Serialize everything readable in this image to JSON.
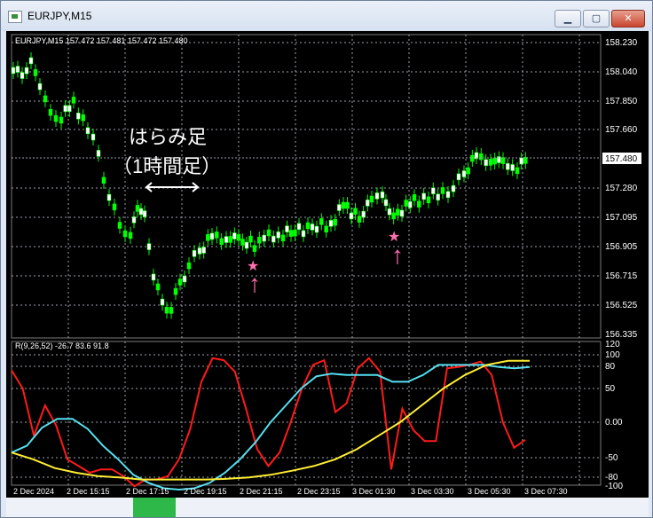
{
  "window": {
    "title": "EURJPY,M15",
    "buttons": {
      "minimize": "▁",
      "maximize": "▢",
      "close": "✕"
    }
  },
  "price_panel": {
    "header": "EURJPY,M15  157.472 157.481 157.472 157.480",
    "current_price": "157.480",
    "y_labels": [
      "158.230",
      "158.040",
      "157.850",
      "157.660",
      "157.470",
      "157.280",
      "157.095",
      "156.905",
      "156.715",
      "156.525",
      "156.335"
    ],
    "annotation_line1": "はらみ足",
    "annotation_line2": "（1時間足）",
    "markers": [
      "★",
      "★"
    ],
    "arrows": [
      "↑",
      "↑"
    ]
  },
  "indicator_panel": {
    "header": "R(9,26,52) -26.7 83.6 91.8",
    "y_labels": [
      "120",
      "100",
      "80",
      "50",
      "0.00",
      "-50",
      "-80",
      "-100"
    ]
  },
  "x_labels": [
    "2 Dec 2024",
    "2 Dec 15:15",
    "2 Dec 17:15",
    "2 Dec 19:15",
    "2 Dec 21:15",
    "2 Dec 23:15",
    "3 Dec 01:30",
    "3 Dec 03:30",
    "3 Dec 05:30",
    "3 Dec 07:30"
  ],
  "colors": {
    "background": "#000000",
    "candle": "#00ff00",
    "grid": "#9aa2ad",
    "red_line": "#ff1a1a",
    "cyan_line": "#55e0f0",
    "yellow_line": "#ffee33",
    "marker": "#ff6fb0",
    "tab_active": "#2fb84a"
  },
  "chart_data": {
    "type": "line",
    "series": [
      {
        "values": [
          77,
          50,
          -20,
          25,
          -5,
          -55,
          -65,
          -75,
          -70,
          -70,
          -80,
          -95,
          -85,
          -85,
          -80,
          -55,
          -10,
          60,
          95,
          92,
          75,
          20,
          -40,
          -65,
          -45,
          0,
          50,
          85,
          92,
          15,
          28,
          80,
          95,
          75,
          -70,
          20,
          -12,
          -28,
          -28,
          80,
          82,
          85,
          90,
          70,
          0,
          -38,
          -26
        ]
      },
      {
        "values": [
          -45,
          -35,
          -8,
          5,
          5,
          -10,
          -35,
          -55,
          -78,
          -90,
          -98,
          -100,
          -98,
          -90,
          -75,
          -55,
          -30,
          0,
          25,
          50,
          68,
          72,
          70,
          70,
          70,
          60,
          60,
          70,
          85,
          85,
          85,
          85,
          82,
          80,
          82
        ]
      },
      {
        "values": [
          -45,
          -55,
          -68,
          -75,
          -80,
          -82,
          -85,
          -85,
          -85,
          -85,
          -84,
          -82,
          -78,
          -72,
          -65,
          -55,
          -40,
          -20,
          0,
          25,
          50,
          70,
          85,
          91,
          91
        ]
      }
    ]
  }
}
